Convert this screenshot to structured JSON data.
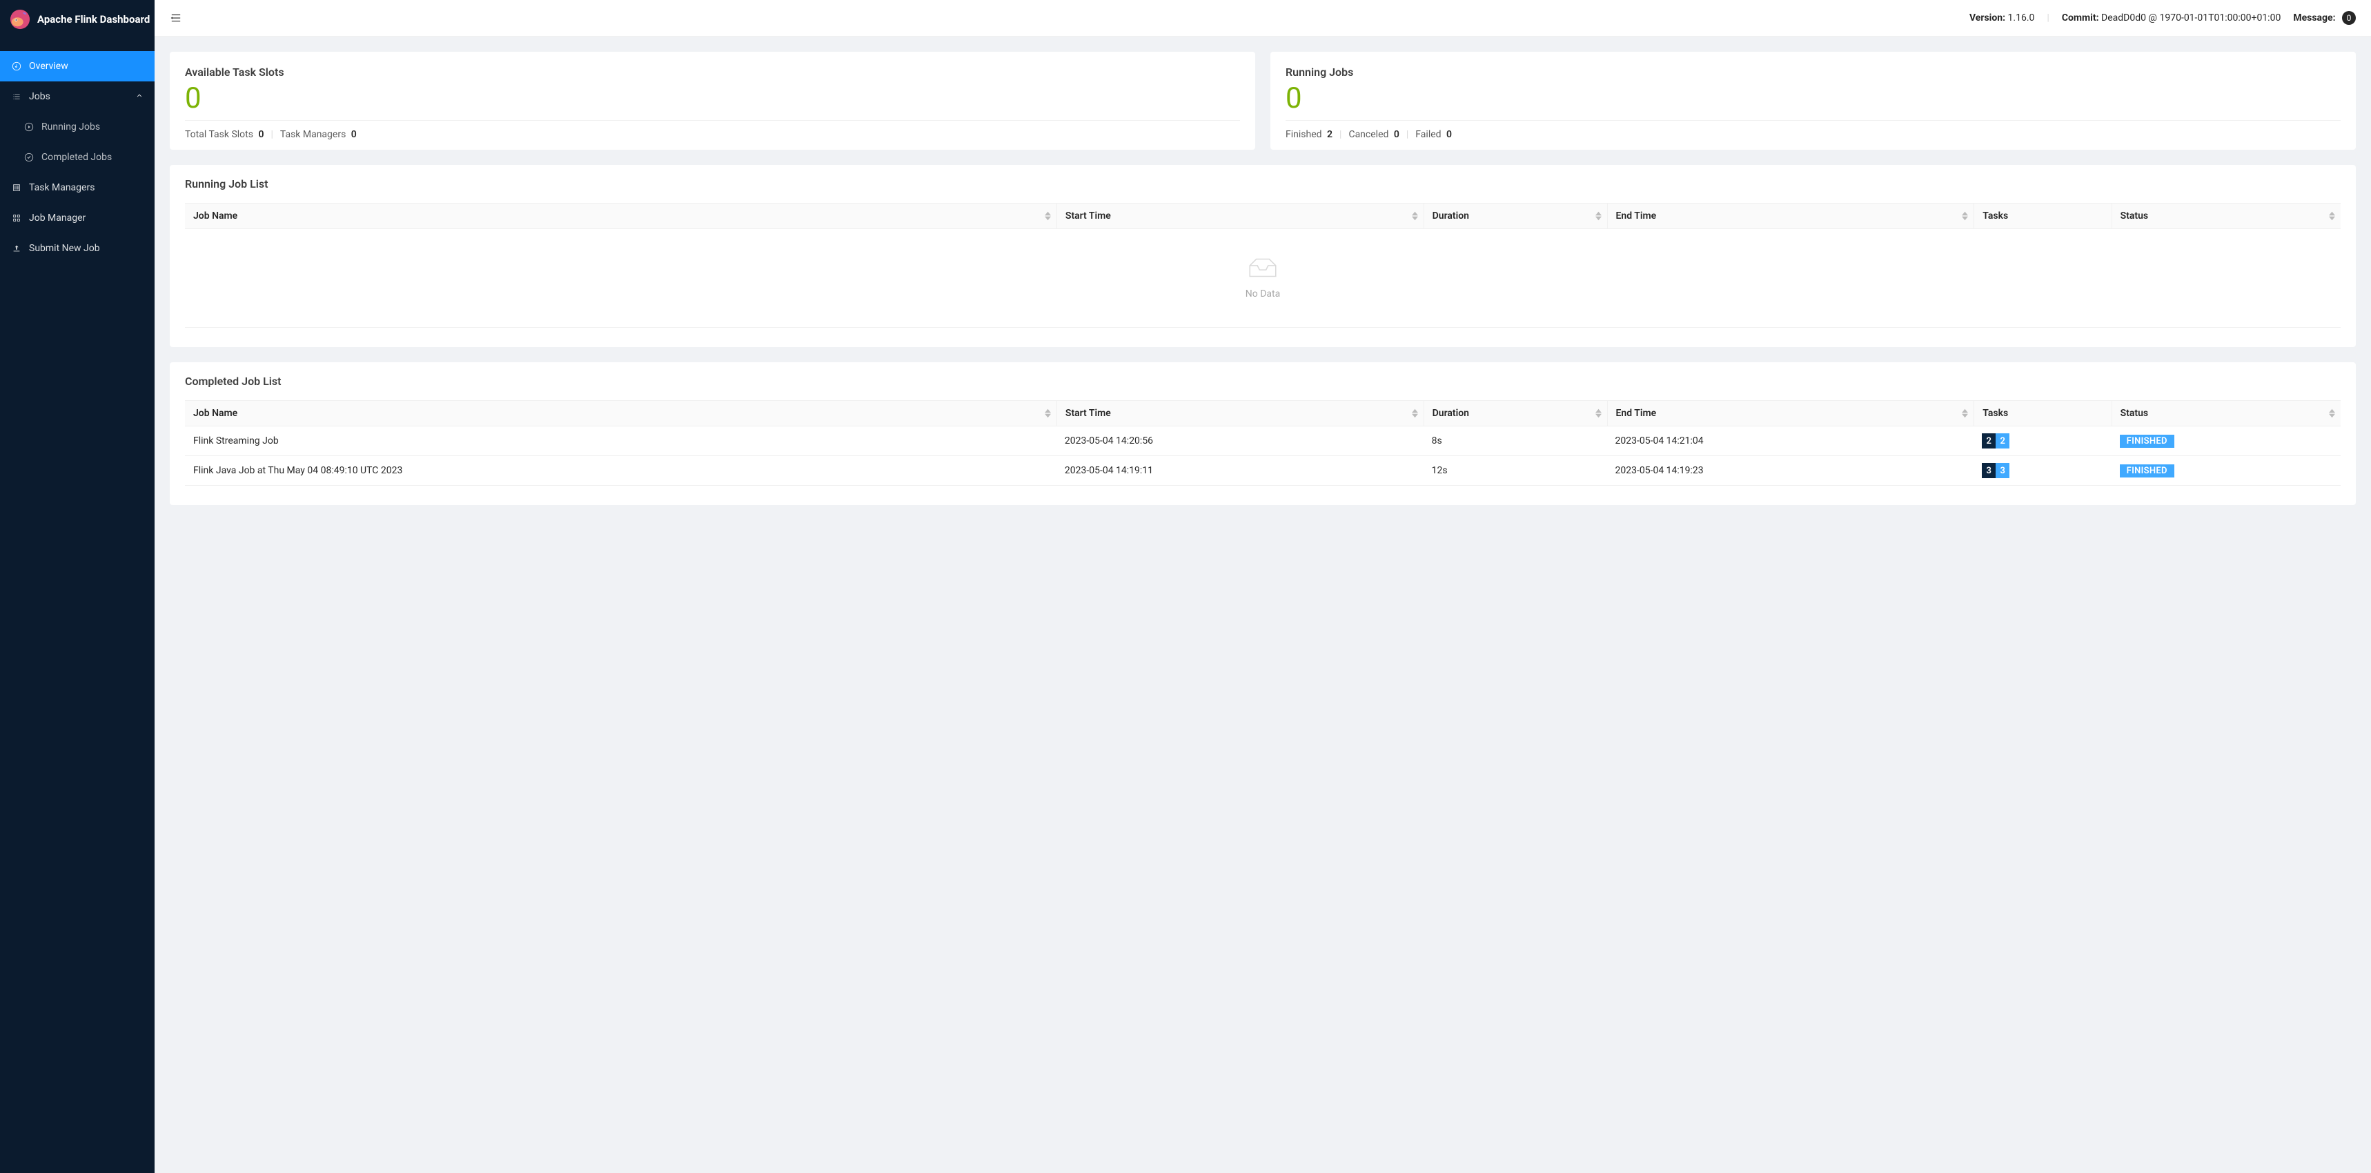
{
  "app": {
    "title": "Apache Flink Dashboard"
  },
  "header": {
    "version_label": "Version:",
    "version": "1.16.0",
    "commit_label": "Commit:",
    "commit": "DeadD0d0 @ 1970-01-01T01:00:00+01:00",
    "message_label": "Message:",
    "message_count": "0"
  },
  "sidebar": {
    "overview": "Overview",
    "jobs": "Jobs",
    "running_jobs": "Running Jobs",
    "completed_jobs": "Completed Jobs",
    "task_managers": "Task Managers",
    "job_manager": "Job Manager",
    "submit_new_job": "Submit New Job"
  },
  "stats": {
    "slots": {
      "title": "Available Task Slots",
      "value": "0",
      "total_label": "Total Task Slots",
      "total_value": "0",
      "managers_label": "Task Managers",
      "managers_value": "0"
    },
    "running": {
      "title": "Running Jobs",
      "value": "0",
      "finished_label": "Finished",
      "finished_value": "2",
      "canceled_label": "Canceled",
      "canceled_value": "0",
      "failed_label": "Failed",
      "failed_value": "0"
    }
  },
  "running_list": {
    "title": "Running Job List",
    "columns": {
      "name": "Job Name",
      "start": "Start Time",
      "duration": "Duration",
      "end": "End Time",
      "tasks": "Tasks",
      "status": "Status"
    },
    "empty": "No Data"
  },
  "completed_list": {
    "title": "Completed Job List",
    "columns": {
      "name": "Job Name",
      "start": "Start Time",
      "duration": "Duration",
      "end": "End Time",
      "tasks": "Tasks",
      "status": "Status"
    },
    "rows": [
      {
        "name": "Flink Streaming Job",
        "start": "2023-05-04 14:20:56",
        "duration": "8s",
        "end": "2023-05-04 14:21:04",
        "tasks_a": "2",
        "tasks_b": "2",
        "status": "FINISHED"
      },
      {
        "name": "Flink Java Job at Thu May 04 08:49:10 UTC 2023",
        "start": "2023-05-04 14:19:11",
        "duration": "12s",
        "end": "2023-05-04 14:19:23",
        "tasks_a": "3",
        "tasks_b": "3",
        "status": "FINISHED"
      }
    ]
  }
}
